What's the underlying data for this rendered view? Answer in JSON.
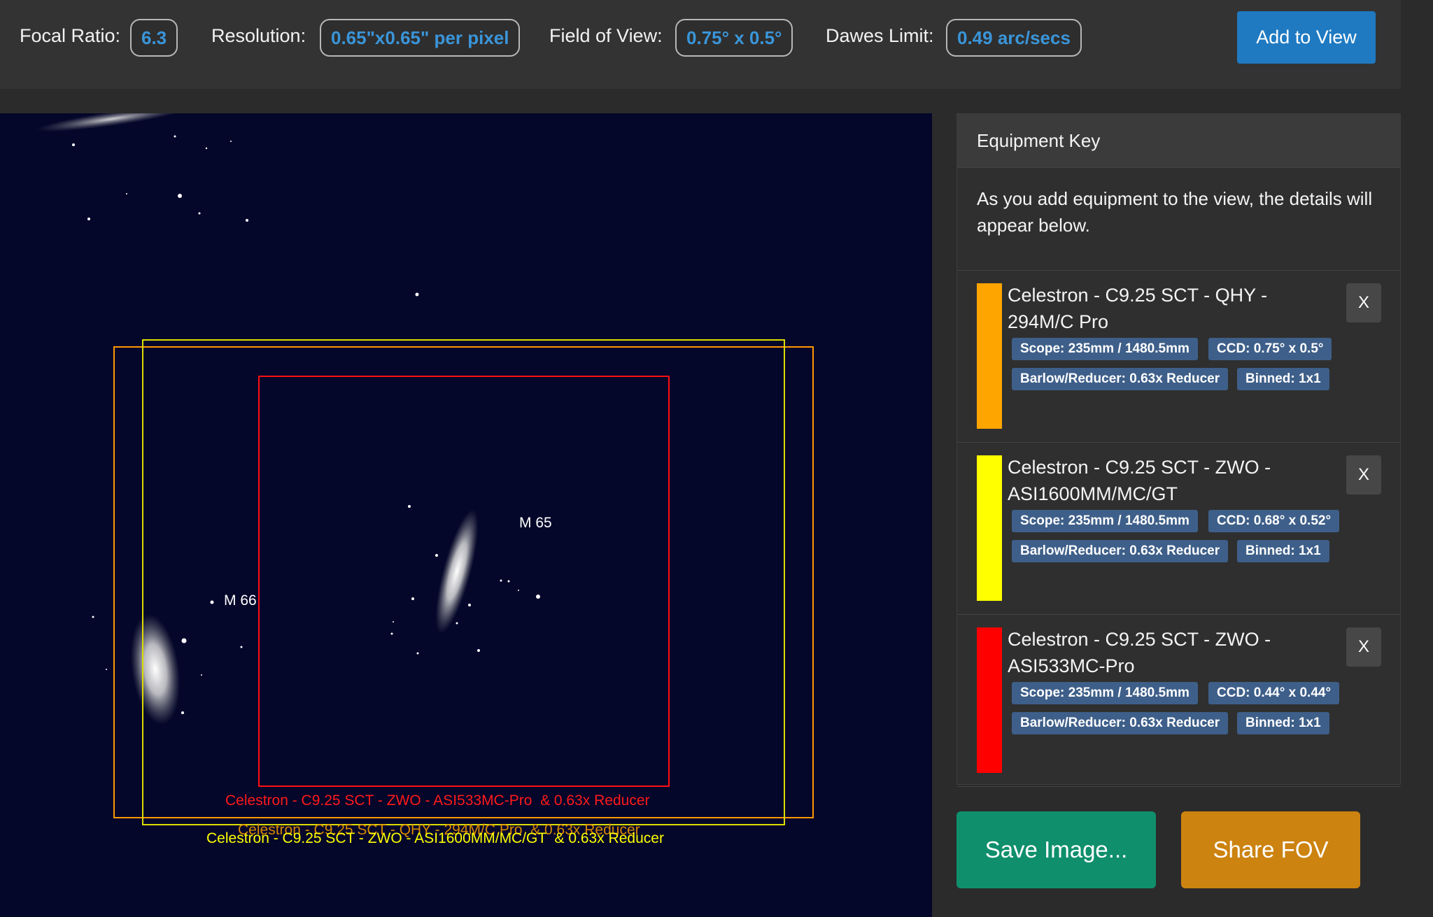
{
  "stats": {
    "focal_ratio_label": "Focal Ratio:",
    "focal_ratio_value": "6.3",
    "resolution_label": "Resolution:",
    "resolution_value": "0.65\"x0.65\" per pixel",
    "fov_label": "Field of View:",
    "fov_value": "0.75° x 0.5°",
    "dawes_label": "Dawes Limit:",
    "dawes_value": "0.49 arc/secs",
    "add_button": "Add to View"
  },
  "sky": {
    "object_m65": "M 65",
    "object_m66": "M 66",
    "overlay_red": "Celestron - C9.25 SCT - ZWO - ASI533MC-Pro  & 0.63x Reducer",
    "overlay_orange": "Celestron - C9.25 SCT - QHY - 294M/C Pro  & 0.63x Reducer",
    "overlay_yellow": "Celestron - C9.25 SCT - ZWO - ASI1600MM/MC/GT  & 0.63x Reducer"
  },
  "panel": {
    "title": "Equipment Key",
    "intro": "As you add equipment to the view, the details will appear below.",
    "remove_label": "X",
    "items": [
      {
        "color": "#ffa500",
        "name": "Celestron - C9.25 SCT - QHY - 294M/C Pro",
        "scope": "Scope: 235mm / 1480.5mm",
        "ccd": "CCD: 0.75° x 0.5°",
        "barlow": "Barlow/Reducer: 0.63x Reducer",
        "binned": "Binned: 1x1"
      },
      {
        "color": "#ffff00",
        "name": "Celestron - C9.25 SCT - ZWO - ASI1600MM/MC/GT",
        "scope": "Scope: 235mm / 1480.5mm",
        "ccd": "CCD: 0.68° x 0.52°",
        "barlow": "Barlow/Reducer: 0.63x Reducer",
        "binned": "Binned: 1x1"
      },
      {
        "color": "#ff0000",
        "name": "Celestron - C9.25 SCT - ZWO - ASI533MC-Pro",
        "scope": "Scope: 235mm / 1480.5mm",
        "ccd": "CCD: 0.44° x 0.44°",
        "barlow": "Barlow/Reducer: 0.63x Reducer",
        "binned": "Binned: 1x1"
      }
    ]
  },
  "actions": {
    "save": "Save Image...",
    "share": "Share FOV"
  }
}
